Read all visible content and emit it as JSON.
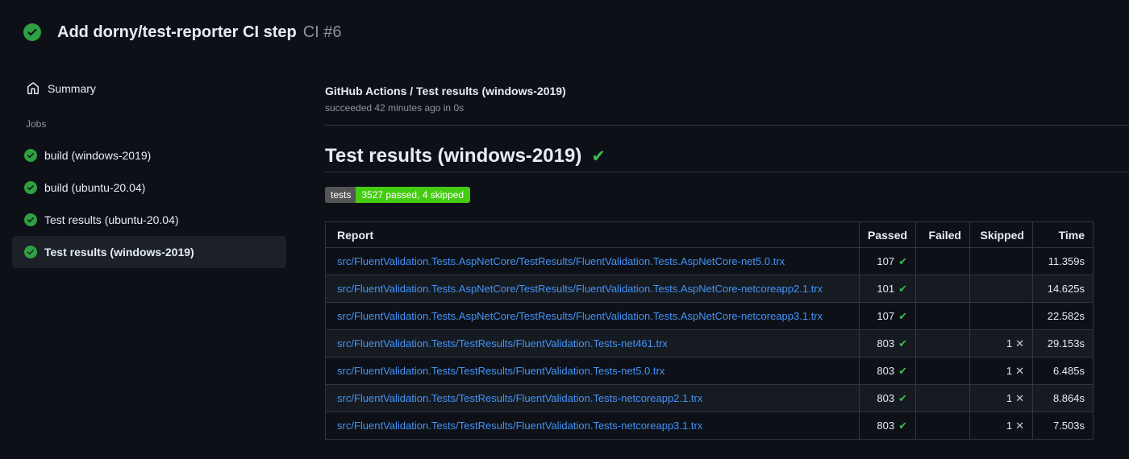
{
  "colors": {
    "bg": "#0d1117",
    "fg": "#e6edf3",
    "muted": "#8b949e",
    "border": "#30363d",
    "link": "#4493f8",
    "success": "#2ea043",
    "check": "#3fb950",
    "cross": "#c6cdd5",
    "selected": "#1c2128",
    "rowalt": "#161b22",
    "badgel": "#555555",
    "badgev": "#44cc11"
  },
  "glyphs": {
    "check": "✔",
    "cross": "✕"
  },
  "run_header": {
    "title": "Add dorny/test-reporter CI step",
    "run_number": "CI #6"
  },
  "sidebar": {
    "summary_label": "Summary",
    "jobs_heading": "Jobs",
    "jobs": [
      {
        "label": "build (windows-2019)"
      },
      {
        "label": "build (ubuntu-20.04)"
      },
      {
        "label": "Test results (ubuntu-20.04)"
      },
      {
        "label": "Test results (windows-2019)",
        "selected": true
      }
    ]
  },
  "job_panel": {
    "title": "GitHub Actions / Test results (windows-2019)",
    "status": "succeeded 42 minutes ago in 0s"
  },
  "report": {
    "heading": "Test results (windows-2019)",
    "badge": {
      "label": "tests",
      "value": "3527 passed, 4 skipped"
    },
    "table": {
      "headers": [
        "Report",
        "Passed",
        "Failed",
        "Skipped",
        "Time"
      ],
      "rows": [
        {
          "report": "src/FluentValidation.Tests.AspNetCore/TestResults/FluentValidation.Tests.AspNetCore-net5.0.trx",
          "passed": "107",
          "failed": "",
          "skipped": "",
          "time": "11.359s"
        },
        {
          "report": "src/FluentValidation.Tests.AspNetCore/TestResults/FluentValidation.Tests.AspNetCore-netcoreapp2.1.trx",
          "passed": "101",
          "failed": "",
          "skipped": "",
          "time": "14.625s"
        },
        {
          "report": "src/FluentValidation.Tests.AspNetCore/TestResults/FluentValidation.Tests.AspNetCore-netcoreapp3.1.trx",
          "passed": "107",
          "failed": "",
          "skipped": "",
          "time": "22.582s"
        },
        {
          "report": "src/FluentValidation.Tests/TestResults/FluentValidation.Tests-net461.trx",
          "passed": "803",
          "failed": "",
          "skipped": "1",
          "time": "29.153s"
        },
        {
          "report": "src/FluentValidation.Tests/TestResults/FluentValidation.Tests-net5.0.trx",
          "passed": "803",
          "failed": "",
          "skipped": "1",
          "time": "6.485s"
        },
        {
          "report": "src/FluentValidation.Tests/TestResults/FluentValidation.Tests-netcoreapp2.1.trx",
          "passed": "803",
          "failed": "",
          "skipped": "1",
          "time": "8.864s"
        },
        {
          "report": "src/FluentValidation.Tests/TestResults/FluentValidation.Tests-netcoreapp3.1.trx",
          "passed": "803",
          "failed": "",
          "skipped": "1",
          "time": "7.503s"
        }
      ]
    }
  }
}
